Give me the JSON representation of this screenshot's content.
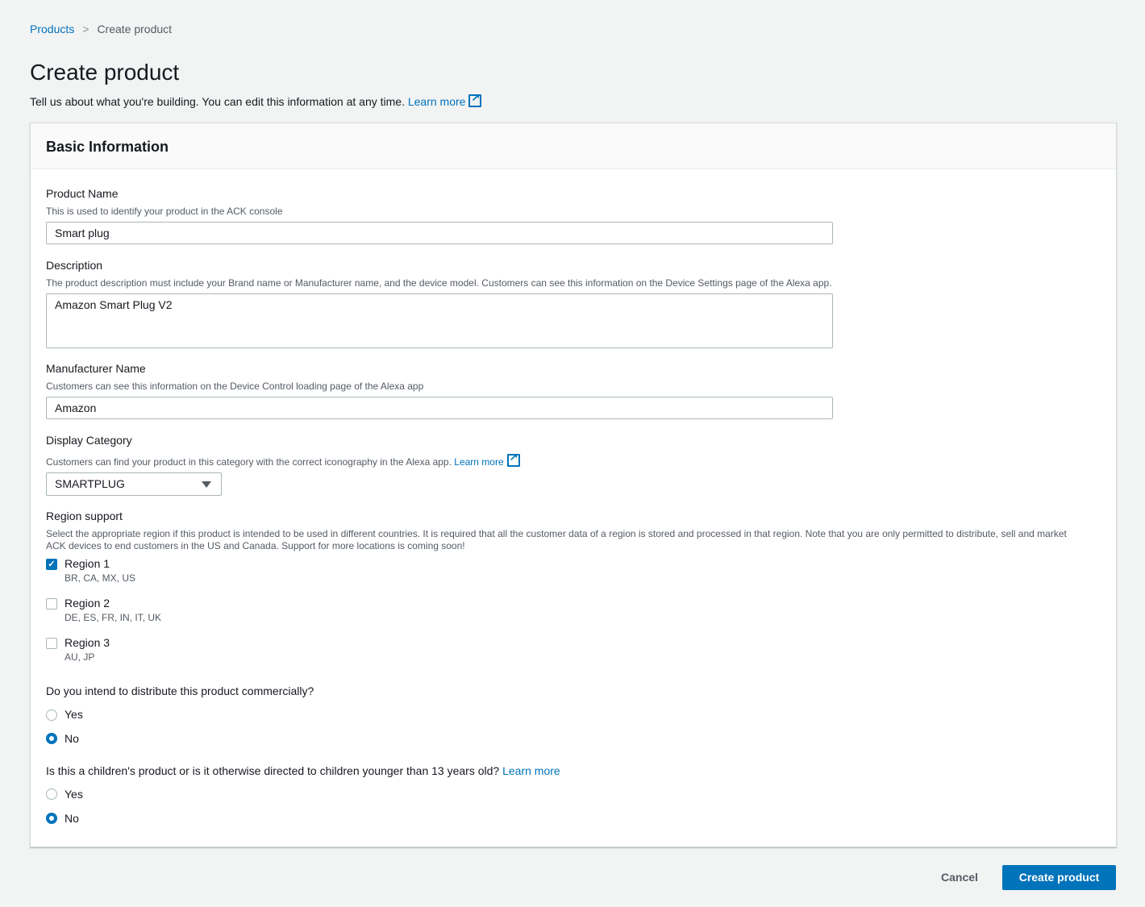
{
  "breadcrumb": {
    "parent": "Products",
    "current": "Create product"
  },
  "page": {
    "title": "Create product",
    "subtitle": "Tell us about what you're building. You can edit this information at any time.",
    "learn_more": "Learn more"
  },
  "panel": {
    "title": "Basic Information"
  },
  "product_name": {
    "label": "Product Name",
    "desc": "This is used to identify your product in the ACK console",
    "value": "Smart plug"
  },
  "description": {
    "label": "Description",
    "desc": "The product description must include your Brand name or Manufacturer name, and the device model. Customers can see this information on the Device Settings page of the Alexa app.",
    "value": "Amazon Smart Plug V2"
  },
  "manufacturer": {
    "label": "Manufacturer Name",
    "desc": "Customers can see this information on the Device Control loading page of the Alexa app",
    "value": "Amazon"
  },
  "category": {
    "label": "Display Category",
    "desc": "Customers can find your product in this category with the correct iconography in the Alexa app.",
    "learn_more": "Learn more",
    "value": "SMARTPLUG"
  },
  "region": {
    "label": "Region support",
    "desc1": "Select the appropriate region if this product is intended to be used in different countries. It is required that all the customer data of a region is stored and processed in that region. Note that you are only permitted to distribute, sell and market",
    "desc2": "ACK devices to end customers in the US and Canada. Support for more locations is coming soon!",
    "options": [
      {
        "label": "Region 1",
        "countries": "BR, CA, MX, US",
        "checked": true
      },
      {
        "label": "Region 2",
        "countries": "DE, ES, FR, IN, IT, UK",
        "checked": false
      },
      {
        "label": "Region 3",
        "countries": "AU, JP",
        "checked": false
      }
    ]
  },
  "commercial": {
    "question": "Do you intend to distribute this product commercially?",
    "yes": "Yes",
    "no": "No",
    "selected": "No"
  },
  "children": {
    "question": "Is this a children's product or is it otherwise directed to children younger than 13 years old?",
    "learn_more": "Learn more",
    "yes": "Yes",
    "no": "No",
    "selected": "No"
  },
  "actions": {
    "cancel": "Cancel",
    "submit": "Create product"
  },
  "colors": {
    "accent": "#0073bb",
    "background": "#f2f3f3"
  }
}
